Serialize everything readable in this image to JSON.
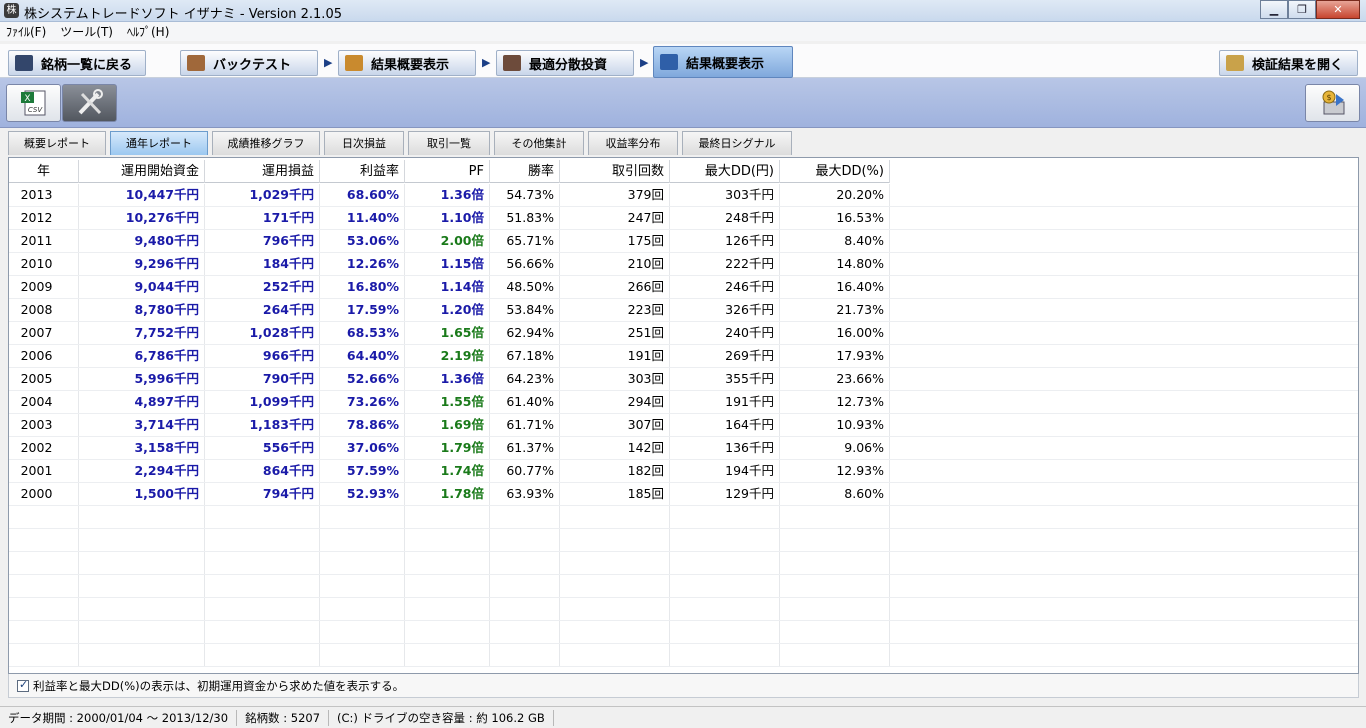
{
  "window": {
    "title": "株システムトレードソフト イザナミ - Version 2.1.05",
    "minimize_icon": "minimize-icon",
    "maximize_icon": "maximize-icon",
    "close_icon": "close-icon"
  },
  "menu": [
    "ﾌｧｲﾙ(F)",
    "ツール(T)",
    "ﾍﾙﾌﾟ(H)"
  ],
  "nav": {
    "back": "銘柄一覧に戻る",
    "backtest": "バックテスト",
    "summary1": "結果概要表示",
    "optimal": "最適分散投資",
    "summary2": "結果概要表示",
    "open_results": "検証結果を開く"
  },
  "toolbar": {
    "csv_label": "CSV",
    "tools_icon": "tools-icon",
    "export_icon": "money-export-icon"
  },
  "subtabs": [
    "概要レポート",
    "通年レポート",
    "成績推移グラフ",
    "日次損益",
    "取引一覧",
    "その他集計",
    "収益率分布",
    "最終日シグナル"
  ],
  "table": {
    "headers": [
      "年",
      "運用開始資金",
      "運用損益",
      "利益率",
      "PF",
      "勝率",
      "取引回数",
      "最大DD(円)",
      "最大DD(%)"
    ],
    "rows": [
      [
        "2013",
        "10,447千円",
        "1,029千円",
        "68.60%",
        "1.36倍",
        "54.73%",
        "379回",
        "303千円",
        "20.20%"
      ],
      [
        "2012",
        "10,276千円",
        "171千円",
        "11.40%",
        "1.10倍",
        "51.83%",
        "247回",
        "248千円",
        "16.53%"
      ],
      [
        "2011",
        "9,480千円",
        "796千円",
        "53.06%",
        "2.00倍",
        "65.71%",
        "175回",
        "126千円",
        "8.40%"
      ],
      [
        "2010",
        "9,296千円",
        "184千円",
        "12.26%",
        "1.15倍",
        "56.66%",
        "210回",
        "222千円",
        "14.80%"
      ],
      [
        "2009",
        "9,044千円",
        "252千円",
        "16.80%",
        "1.14倍",
        "48.50%",
        "266回",
        "246千円",
        "16.40%"
      ],
      [
        "2008",
        "8,780千円",
        "264千円",
        "17.59%",
        "1.20倍",
        "53.84%",
        "223回",
        "326千円",
        "21.73%"
      ],
      [
        "2007",
        "7,752千円",
        "1,028千円",
        "68.53%",
        "1.65倍",
        "62.94%",
        "251回",
        "240千円",
        "16.00%"
      ],
      [
        "2006",
        "6,786千円",
        "966千円",
        "64.40%",
        "2.19倍",
        "67.18%",
        "191回",
        "269千円",
        "17.93%"
      ],
      [
        "2005",
        "5,996千円",
        "790千円",
        "52.66%",
        "1.36倍",
        "64.23%",
        "303回",
        "355千円",
        "23.66%"
      ],
      [
        "2004",
        "4,897千円",
        "1,099千円",
        "73.26%",
        "1.55倍",
        "61.40%",
        "294回",
        "191千円",
        "12.73%"
      ],
      [
        "2003",
        "3,714千円",
        "1,183千円",
        "78.86%",
        "1.69倍",
        "61.71%",
        "307回",
        "164千円",
        "10.93%"
      ],
      [
        "2002",
        "3,158千円",
        "556千円",
        "37.06%",
        "1.79倍",
        "61.37%",
        "142回",
        "136千円",
        "9.06%"
      ],
      [
        "2001",
        "2,294千円",
        "864千円",
        "57.59%",
        "1.74倍",
        "60.77%",
        "182回",
        "194千円",
        "12.93%"
      ],
      [
        "2000",
        "1,500千円",
        "794千円",
        "52.93%",
        "1.78倍",
        "63.93%",
        "185回",
        "129千円",
        "8.60%"
      ]
    ]
  },
  "footnote": "利益率と最大DD(%)の表示は、初期運用資金から求めた値を表示する。",
  "status": [
    "データ期間 : 2000/01/04 〜 2013/12/30",
    "銘柄数 : 5207",
    "(C:) ドライブの空き容量 : 約 106.2 GB"
  ],
  "colors": {
    "blue_text": "#1a1aa8",
    "green_text": "#1a7a1a",
    "toolbar_bg": "#a9bae0",
    "active_tab": "#9cc8f0"
  }
}
